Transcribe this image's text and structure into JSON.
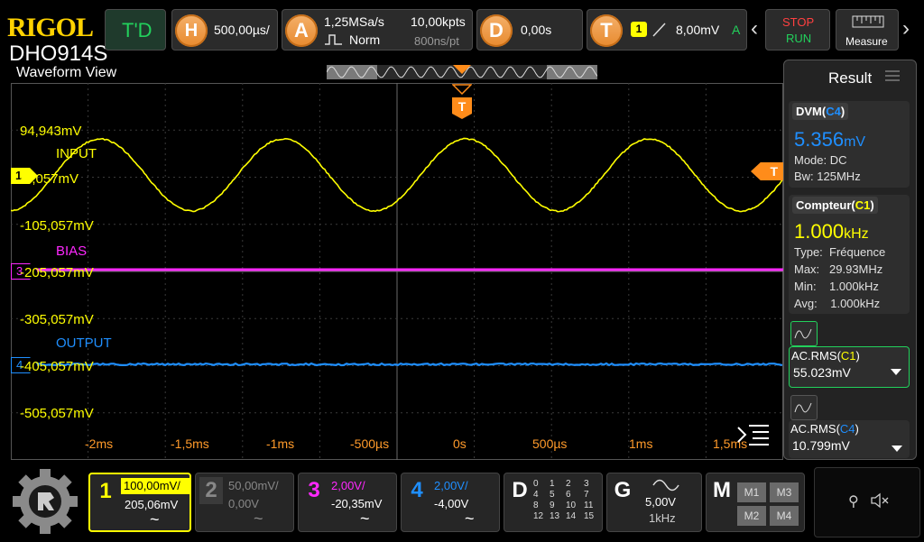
{
  "brand": {
    "logo": "RIGOL",
    "model": "DHO914S"
  },
  "top_bar": {
    "td_label": "T'D",
    "h_label": "H",
    "h_value": "500,00µs/",
    "a_label": "A",
    "a_rate": "1,25MSa/s",
    "a_mode": "Norm",
    "a_pts": "10,00kpts",
    "a_ptime": "800ns/pt",
    "d_label": "D",
    "d_value": "0,00s",
    "t_label": "T",
    "t_source": "1",
    "t_level": "8,00mV",
    "t_mode": "A",
    "stop_label": "STOP",
    "run_label": "RUN",
    "measure_label": "Measure"
  },
  "waveform": {
    "view_label": "Waveform View",
    "trigger_marker": "T",
    "right_trigger_marker": "T",
    "ch1_marker": "1",
    "ch3_marker": "3",
    "ch4_marker": "4",
    "labels": {
      "v1": "94,943mV",
      "input": "INPUT",
      "v2": "-5,057mV",
      "v3": "-105,057mV",
      "bias": "BIAS",
      "v4": "-205,057mV",
      "v5": "-305,057mV",
      "output": "OUTPUT",
      "v6": "-405,057mV",
      "v7": "-505,057mV"
    },
    "x_ticks": [
      "-2ms",
      "-1,5ms",
      "-1ms",
      "-500µs",
      "0s",
      "500µs",
      "1ms",
      "1,5ms"
    ]
  },
  "result_panel": {
    "title": "Result",
    "dvm": {
      "title": "DVM",
      "src": "C4",
      "value": "5.356",
      "unit": "mV",
      "mode": "Mode: DC",
      "bw": "Bw:    125MHz"
    },
    "counter": {
      "title": "Compteur",
      "src": "C1",
      "value": "1.000",
      "unit": "kHz",
      "rows": [
        {
          "k": "Type:",
          "v": "Fréquence"
        },
        {
          "k": "Max:",
          "v": "29.93MHz"
        },
        {
          "k": "Min:",
          "v": "1.000kHz"
        },
        {
          "k": "Avg:",
          "v": "1.000kHz"
        }
      ]
    },
    "acrms1": {
      "title": "AC.RMS",
      "src": "C1",
      "value": "55.023mV"
    },
    "acrms4": {
      "title": "AC.RMS",
      "src": "C4",
      "value": "10.799mV"
    }
  },
  "bottom_bar": {
    "ch1": {
      "num": "1",
      "scale": "100,00mV/",
      "offset": "205,06mV",
      "coupling": "~"
    },
    "ch2": {
      "num": "2",
      "scale": "50,00mV/",
      "offset": "0,00V",
      "coupling": "~"
    },
    "ch3": {
      "num": "3",
      "scale": "2,00V/",
      "offset": "-20,35mV",
      "coupling": "~"
    },
    "ch4": {
      "num": "4",
      "scale": "2,00V/",
      "offset": "-4,00V",
      "coupling": "~"
    },
    "digital": {
      "label": "D",
      "rows": [
        [
          "0",
          "1",
          "2",
          "3"
        ],
        [
          "4",
          "5",
          "6",
          "7"
        ],
        [
          "8",
          "9",
          "10",
          "11"
        ],
        [
          "12",
          "13",
          "14",
          "15"
        ]
      ]
    },
    "gen": {
      "label": "G",
      "amp": "5,00V",
      "freq": "1kHz"
    },
    "math": {
      "label": "M",
      "m1": "M1",
      "m2": "M2",
      "m3": "M3",
      "m4": "M4"
    }
  },
  "colors": {
    "ch1": "#ffff00",
    "ch3": "#ff28ff",
    "ch4": "#1f8fff",
    "trigger": "#ff8c1a",
    "grid": "#3a3a3a"
  }
}
